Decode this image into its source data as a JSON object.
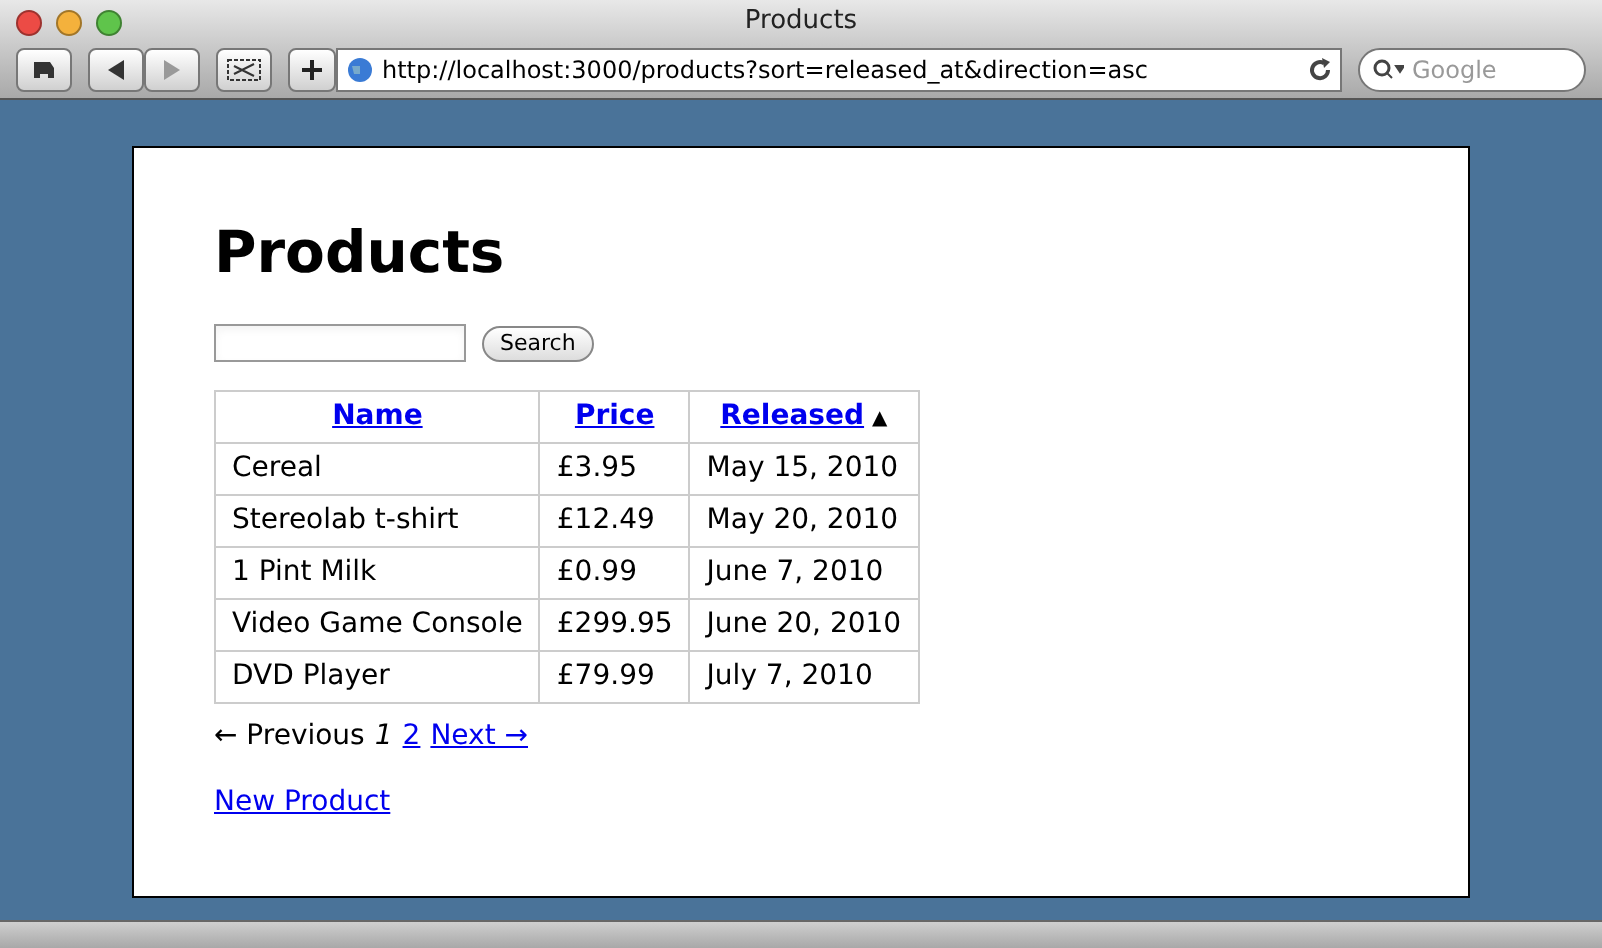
{
  "window": {
    "title": "Products"
  },
  "toolbar": {
    "url": "http://localhost:3000/products?sort=released_at&direction=asc",
    "search_placeholder": "Google"
  },
  "page": {
    "heading": "Products",
    "search_button": "Search",
    "table": {
      "columns": [
        {
          "label": "Name"
        },
        {
          "label": "Price"
        },
        {
          "label": "Released",
          "sort_indicator": "▲"
        }
      ],
      "rows": [
        [
          "Cereal",
          "£3.95",
          "May 15, 2010"
        ],
        [
          "Stereolab t-shirt",
          "£12.49",
          "May 20, 2010"
        ],
        [
          "1 Pint Milk",
          "£0.99",
          "June 7, 2010"
        ],
        [
          "Video Game Console",
          "£299.95",
          "June 20, 2010"
        ],
        [
          "DVD Player",
          "£79.99",
          "July 7, 2010"
        ]
      ]
    },
    "pagination": [
      {
        "kind": "disabled",
        "label": "← Previous"
      },
      {
        "kind": "current",
        "label": "1"
      },
      {
        "kind": "link",
        "label": "2"
      },
      {
        "kind": "link",
        "label": "Next →"
      }
    ],
    "new_link": "New Product"
  }
}
